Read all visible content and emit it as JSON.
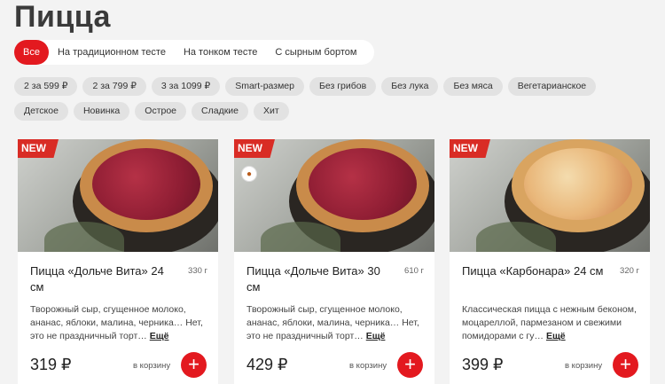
{
  "page_title": "Пицца",
  "tabs": [
    {
      "label": "Все",
      "active": true
    },
    {
      "label": "На традиционном тесте",
      "active": false
    },
    {
      "label": "На тонком тесте",
      "active": false
    },
    {
      "label": "С сырным бортом",
      "active": false
    }
  ],
  "filters": [
    "2 за 599 ₽",
    "2 за 799 ₽",
    "3 за 1099 ₽",
    "Smart-размер",
    "Без грибов",
    "Без лука",
    "Без мяса",
    "Вегетарианское",
    "Детское",
    "Новинка",
    "Острое",
    "Сладкие",
    "Хит"
  ],
  "accent_color": "#e3191f",
  "products": [
    {
      "badge": "NEW",
      "name": "Пицца «Дольче Вита» 24 см",
      "weight": "330 г",
      "description": "Творожный сыр, сгущенное молоко, ананас, яблоки, малина, черника… Нет, это не праздничный торт…",
      "more": "Ещё",
      "price": "319 ₽",
      "cart_label": "в корзину",
      "add_icon": "plus-icon",
      "medal_icon": null
    },
    {
      "badge": "NEW",
      "name": "Пицца «Дольче Вита» 30 см",
      "weight": "610 г",
      "description": "Творожный сыр, сгущенное молоко, ананас, яблоки, малина, черника… Нет, это не праздничный торт…",
      "more": "Ещё",
      "price": "429 ₽",
      "cart_label": "в корзину",
      "add_icon": "plus-icon",
      "medal_icon": "medal-icon"
    },
    {
      "badge": "NEW",
      "name": "Пицца «Карбонара» 24 см",
      "weight": "320 г",
      "description": "Классическая пицца с нежным беконом, моцареллой, пармезаном и свежими помидорами с гу…",
      "more": "Ещё",
      "price": "399 ₽",
      "cart_label": "в корзину",
      "add_icon": "plus-icon",
      "medal_icon": null
    }
  ]
}
